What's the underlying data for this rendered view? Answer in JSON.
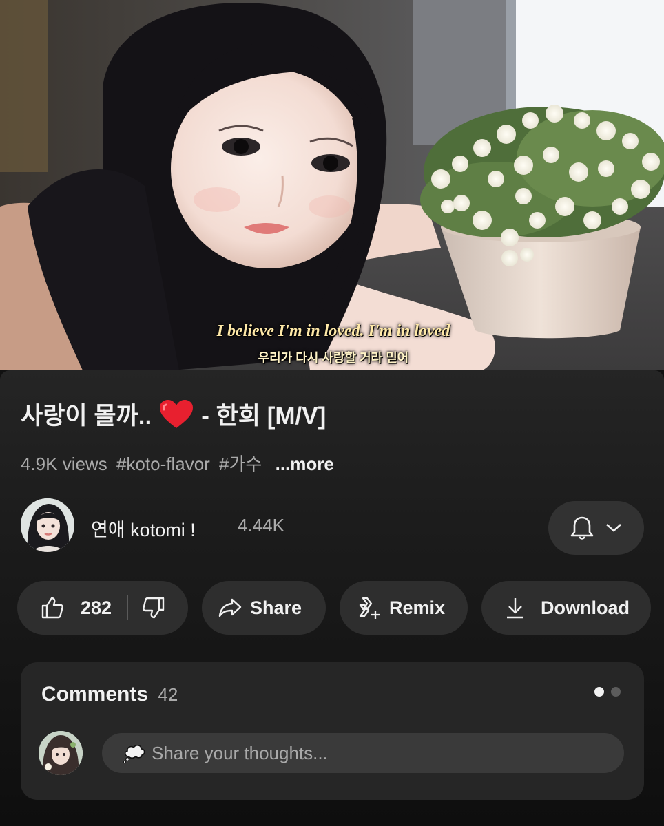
{
  "video": {
    "subtitle_en": "I believe I'm in loved. I'm in loved",
    "subtitle_ko": "우리가 다시 사랑할 거라 믿어"
  },
  "title": {
    "text_before": "사랑이 몰까..",
    "emoji": "heart-emoji",
    "text_after": "- 한희 [M/V]"
  },
  "meta": {
    "views": "4.9K views",
    "tags": [
      "#koto-flavor",
      "#가수"
    ],
    "more_label": "...more"
  },
  "channel": {
    "name": "연애 kotomi !",
    "subscribers": "4.44K",
    "bell_icon": "bell-icon",
    "dropdown_icon": "chevron-down-icon"
  },
  "actions": {
    "like_count": "282",
    "share_label": "Share",
    "remix_label": "Remix",
    "download_label": "Download"
  },
  "comments": {
    "title": "Comments",
    "count": "42",
    "placeholder": "Share your thoughts..."
  },
  "colors": {
    "background": "#0f0f0f",
    "panel": "#252525",
    "pill": "#2e2e2e",
    "heart": "#e8202f"
  }
}
